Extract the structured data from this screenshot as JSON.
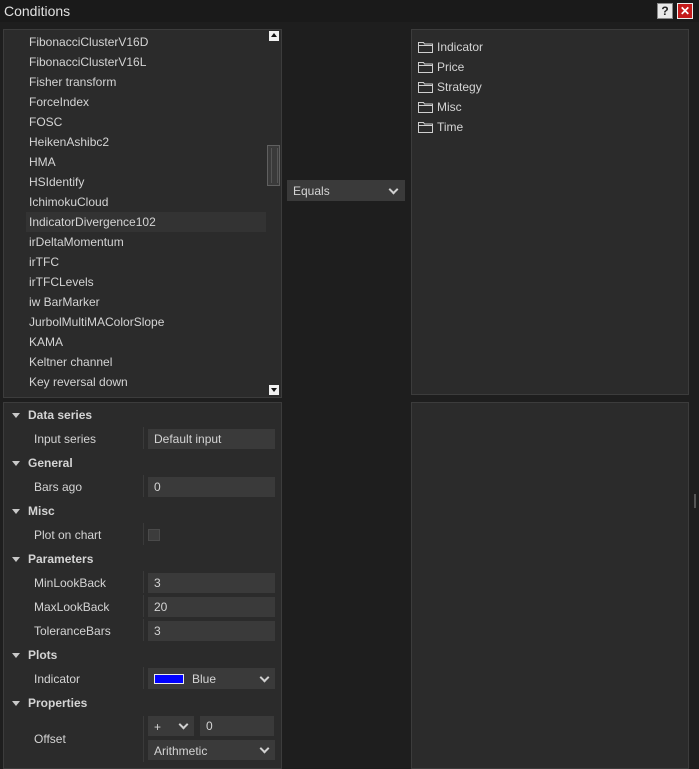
{
  "window": {
    "title": "Conditions",
    "help_label": "?",
    "close_label": "✕"
  },
  "indicator_list": {
    "items": [
      "FibonacciClusterV16D",
      "FibonacciClusterV16L",
      "Fisher transform",
      "ForceIndex",
      "FOSC",
      "HeikenAshibc2",
      "HMA",
      "HSIdentify",
      "IchimokuCloud",
      "IndicatorDivergence102",
      "irDeltaMomentum",
      "irTFC",
      "irTFCLevels",
      "iw BarMarker",
      "JurbolMultiMAColorSlope",
      "KAMA",
      "Keltner channel",
      "Key reversal down"
    ],
    "selected": "IndicatorDivergence102"
  },
  "operator": {
    "value": "Equals"
  },
  "tree": {
    "items": [
      "Indicator",
      "Price",
      "Strategy",
      "Misc",
      "Time"
    ]
  },
  "properties": {
    "data_series": {
      "label": "Data series",
      "input_series_label": "Input series",
      "input_series_value": "Default input"
    },
    "general": {
      "label": "General",
      "bars_ago_label": "Bars ago",
      "bars_ago_value": "0"
    },
    "misc": {
      "label": "Misc",
      "plot_on_chart_label": "Plot on chart",
      "plot_on_chart_checked": false
    },
    "parameters": {
      "label": "Parameters",
      "min_lookback_label": "MinLookBack",
      "min_lookback_value": "3",
      "max_lookback_label": "MaxLookBack",
      "max_lookback_value": "20",
      "tolerance_bars_label": "ToleranceBars",
      "tolerance_bars_value": "3"
    },
    "plots": {
      "label": "Plots",
      "indicator_label": "Indicator",
      "indicator_color_name": "Blue",
      "indicator_color": "#0000ff"
    },
    "props": {
      "label": "Properties",
      "offset_label": "Offset",
      "offset_sign": "+",
      "offset_value": "0",
      "offset_type": "Arithmetic"
    }
  },
  "colors": {
    "background": "#1e1e1e",
    "panel": "#2b2b2b",
    "field": "#3a3a3a",
    "close_button": "#c41a1a"
  }
}
